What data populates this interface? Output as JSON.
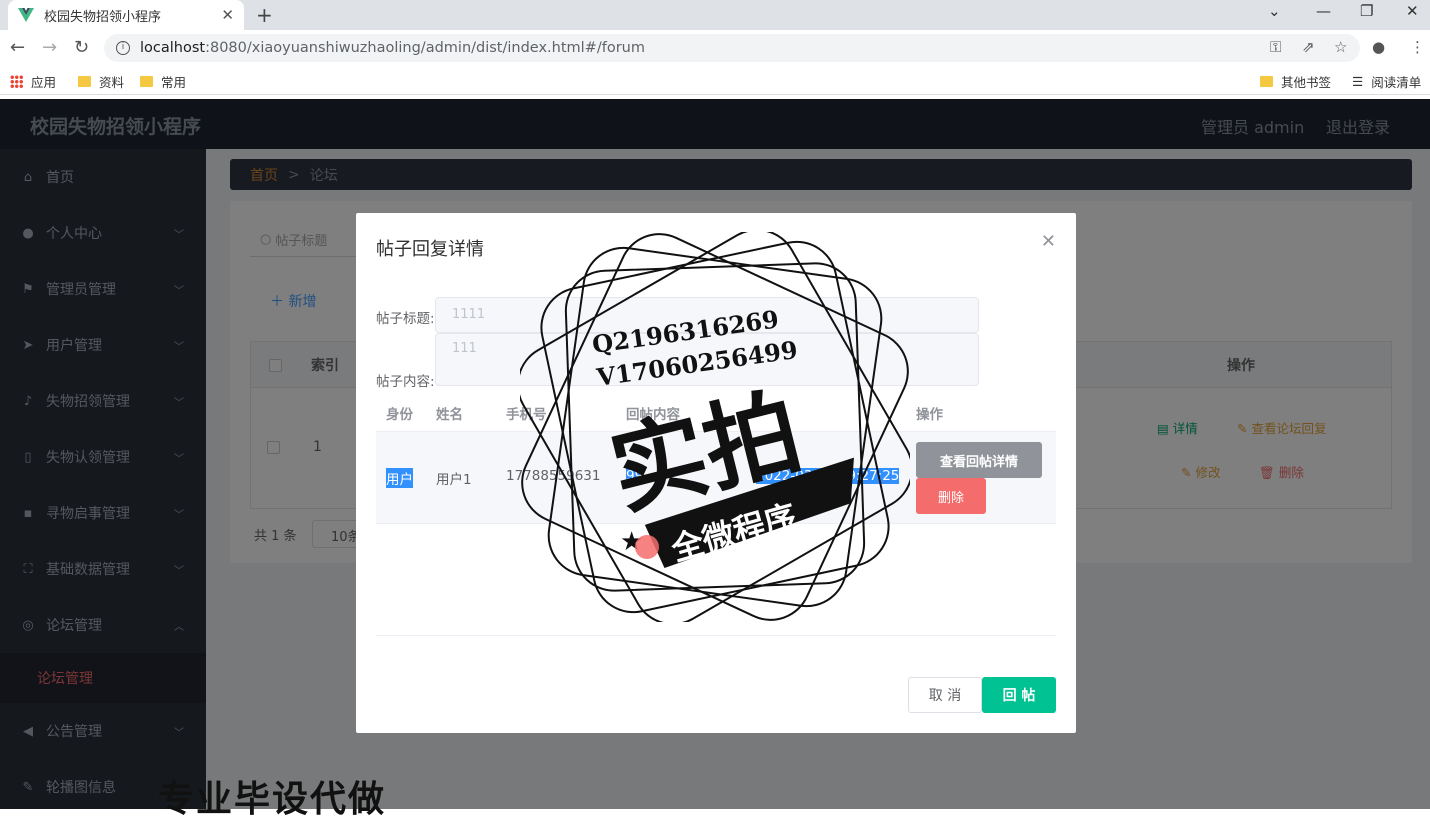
{
  "browser": {
    "tab_title": "校园失物招领小程序",
    "url_host": "localhost",
    "url_path": ":8080/xiaoyuanshiwuzhaoling/admin/dist/index.html#/forum",
    "bookmarks": [
      "应用",
      "资料",
      "常用"
    ],
    "bookmarks_right": [
      "其他书签",
      "阅读清单"
    ]
  },
  "header": {
    "title": "校园失物招领小程序",
    "admin": "管理员 admin",
    "logout": "退出登录"
  },
  "sidebar": {
    "items": [
      {
        "label": "首页",
        "icon": "home-icon"
      },
      {
        "label": "个人中心",
        "icon": "user-icon"
      },
      {
        "label": "管理员管理",
        "icon": "flag-icon"
      },
      {
        "label": "用户管理",
        "icon": "send-icon"
      },
      {
        "label": "失物招领管理",
        "icon": "bell-icon"
      },
      {
        "label": "失物认领管理",
        "icon": "phone-icon"
      },
      {
        "label": "寻物启事管理",
        "icon": "chat-icon"
      },
      {
        "label": "基础数据管理",
        "icon": "scan-icon"
      },
      {
        "label": "论坛管理",
        "icon": "compass-icon"
      },
      {
        "label": "公告管理",
        "icon": "megaphone-icon"
      },
      {
        "label": "轮播图信息",
        "icon": "wrench-icon"
      }
    ],
    "submenu": "论坛管理"
  },
  "breadcrumb": {
    "home": "首页",
    "sep": ">",
    "current": "论坛"
  },
  "page": {
    "search_placeholder": "帖子标题",
    "add_label": "新增",
    "col_index": "索引",
    "col_ops": "操作",
    "row_index": "1",
    "op_detail": "详情",
    "op_view_replies": "查看论坛回复",
    "op_edit": "修改",
    "op_delete": "删除",
    "total": "共 1 条",
    "page_size": "10条"
  },
  "modal": {
    "title": "帖子回复详情",
    "label_title": "帖子标题:",
    "value_title": "1111",
    "label_content": "帖子内容:",
    "value_content": "111",
    "columns": [
      "身份",
      "姓名",
      "手机号",
      "回帖内容",
      "",
      "操作"
    ],
    "row": {
      "role": "用户",
      "name": "用户1",
      "phone": "17788559631",
      "content": "99",
      "time": "2022-03-23 09:27:25"
    },
    "btn_view_detail": "查看回帖详情",
    "btn_delete": "删除",
    "btn_cancel": "取 消",
    "btn_reply": "回 帖"
  },
  "watermark": {
    "line1": "Q2196316269",
    "line2": "V17060256499",
    "big": "实拍",
    "banner": "全微程序",
    "bottom": "专业毕设代做"
  }
}
